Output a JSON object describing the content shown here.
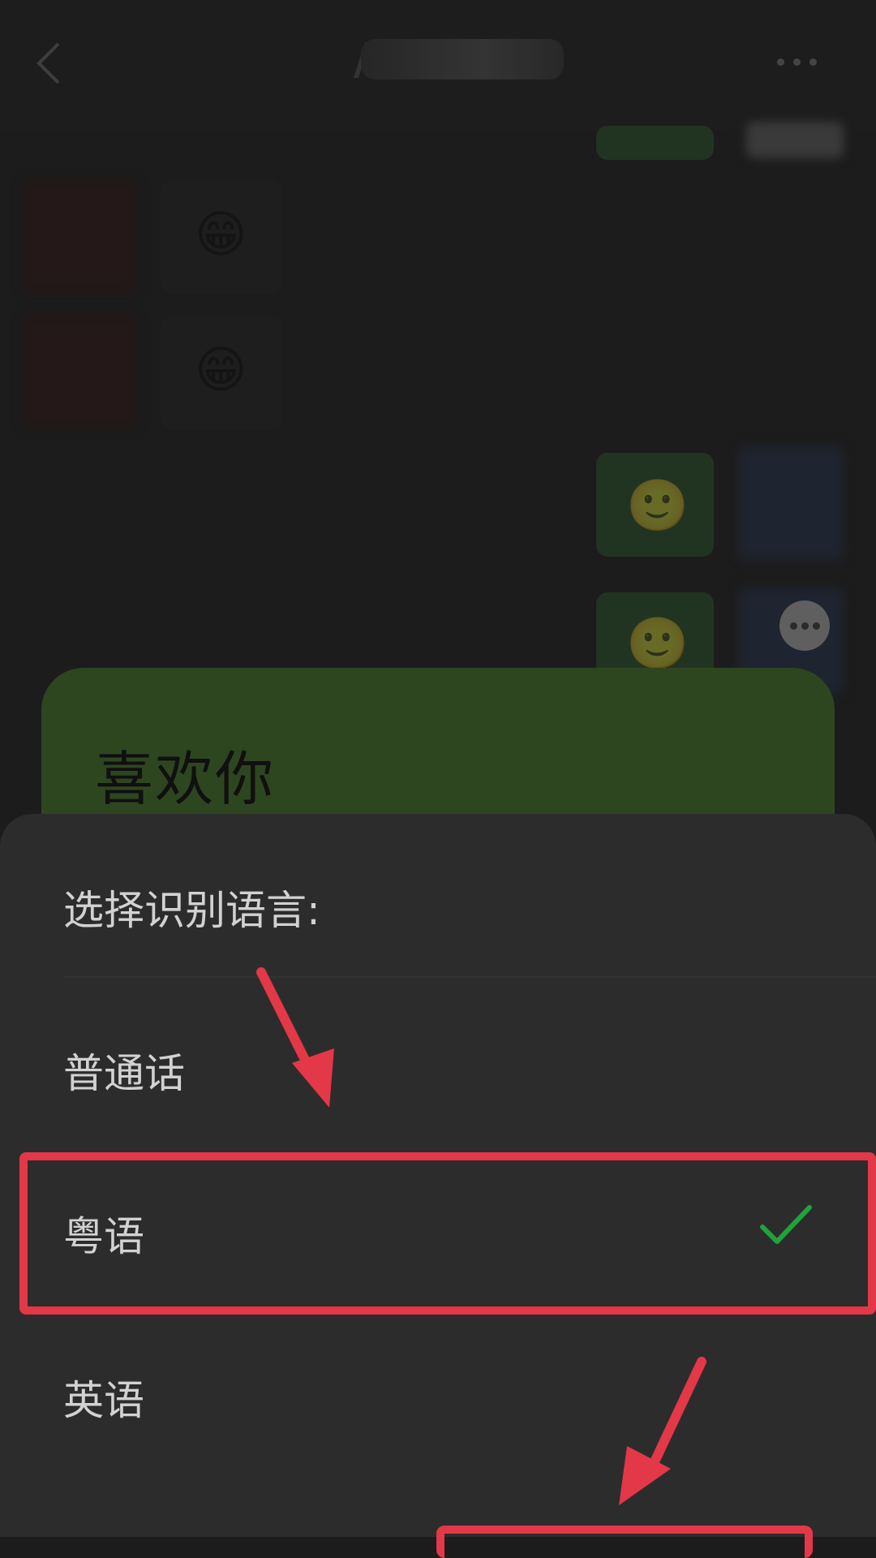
{
  "header": {
    "title": "",
    "back_icon": "chevron-left-icon",
    "more_icon": "more-horizontal-icon"
  },
  "chat": {
    "emojis": [
      "😁",
      "😁",
      "🙂",
      "🙂"
    ]
  },
  "result_card": {
    "text": "喜欢你"
  },
  "language_sheet": {
    "title": "选择识别语言:",
    "options": [
      {
        "label": "普通话",
        "selected": false
      },
      {
        "label": "粤语",
        "selected": true
      },
      {
        "label": "英语",
        "selected": false
      }
    ],
    "check_icon": "checkmark-icon"
  },
  "annotations": {
    "color": "#e23848"
  }
}
